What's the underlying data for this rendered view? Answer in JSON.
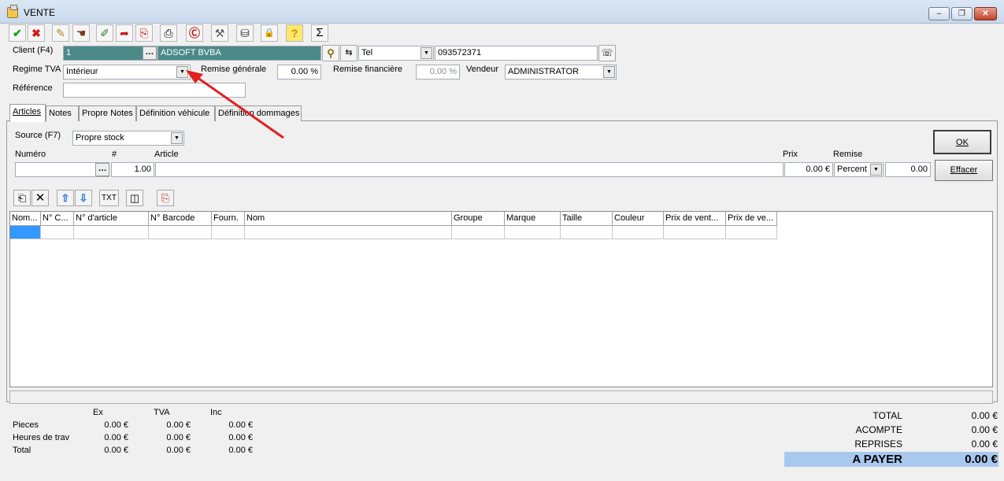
{
  "window": {
    "title": "VENTE",
    "min": "–",
    "max": "❐",
    "close": "✕"
  },
  "toolbar": [
    {
      "name": "confirm-icon",
      "glyph": "✔"
    },
    {
      "name": "cancel-icon",
      "glyph": "✖"
    },
    {
      "name": "note-icon",
      "glyph": "✎"
    },
    {
      "name": "hand-icon",
      "glyph": "☚"
    },
    {
      "name": "pencil-list-icon",
      "glyph": "✐"
    },
    {
      "name": "doc-arrow-icon",
      "glyph": "➦"
    },
    {
      "name": "doc-add-icon",
      "glyph": "⎘"
    },
    {
      "name": "printer-icon",
      "glyph": "⎙"
    },
    {
      "name": "red-c-icon",
      "glyph": "Ⓒ"
    },
    {
      "name": "tool-icon",
      "glyph": "⚒"
    },
    {
      "name": "stamp-icon",
      "glyph": "⛁"
    },
    {
      "name": "lock-icon",
      "glyph": "🔒"
    },
    {
      "name": "help-icon",
      "glyph": "?"
    },
    {
      "name": "sigma-icon",
      "glyph": "Σ"
    }
  ],
  "client": {
    "label": "Client (F4)",
    "number": "1",
    "dots": "…",
    "name": "ADSOFT BVBA",
    "phone_type": "Tel",
    "phone": "093572371"
  },
  "regime": {
    "label": "Regime TVA",
    "value": "Intérieur"
  },
  "remise_generale": {
    "label": "Remise générale",
    "value": "0.00 %"
  },
  "remise_financiere": {
    "label": "Remise financière",
    "value": "0.00 %"
  },
  "vendeur": {
    "label": "Vendeur",
    "value": "ADMINISTRATOR"
  },
  "reference": {
    "label": "Référence",
    "value": ""
  },
  "tabs": [
    "Articles",
    "Notes",
    "Propre Notes",
    "Définition véhicule",
    "Définition dommages"
  ],
  "article_entry": {
    "source_label": "Source (F7)",
    "source_value": "Propre stock",
    "numero_label": "Numéro",
    "qty_label": "#",
    "article_label": "Article",
    "prix_label": "Prix",
    "remise_label": "Remise",
    "qty_value": "1.00",
    "prix_value": "0.00 €",
    "remise_type": "Percent",
    "remise_value": "0.00",
    "ok_label": "OK",
    "effacer_label": "Effacer"
  },
  "grid_toolbar": {
    "txt_label": "TXT"
  },
  "grid": {
    "columns": [
      "Nom...",
      "N° C...",
      "N° d'article",
      "N° Barcode",
      "Fourn.",
      "Nom",
      "Groupe",
      "Marque",
      "Taille",
      "Couleur",
      "Prix de vent...",
      "Prix de ve..."
    ]
  },
  "summary": {
    "headers": [
      "Ex",
      "TVA",
      "Inc"
    ],
    "rows": [
      {
        "label": "Pieces",
        "ex": "0.00 €",
        "tva": "0.00 €",
        "inc": "0.00 €"
      },
      {
        "label": "Heures de trav",
        "ex": "0.00 €",
        "tva": "0.00 €",
        "inc": "0.00 €"
      },
      {
        "label": "Total",
        "ex": "0.00 €",
        "tva": "0.00 €",
        "inc": "0.00 €"
      }
    ]
  },
  "totals": {
    "total_label": "TOTAL",
    "total_value": "0.00 €",
    "acompte_label": "ACOMPTE",
    "acompte_value": "0.00 €",
    "reprises_label": "REPRISES",
    "reprises_value": "0.00 €",
    "apayer_label": "A PAYER",
    "apayer_value": "0.00 €"
  },
  "colors": {
    "teal": "#4c8a8a",
    "arrow": "#e02020",
    "apayer": "#a8c8ee",
    "selected_cell": "#3399ff"
  }
}
